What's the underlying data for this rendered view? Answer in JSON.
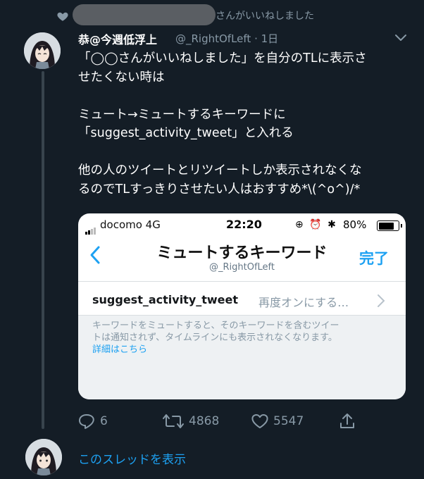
{
  "social_context": {
    "text": "さんがいいねしました"
  },
  "tweet": {
    "author_name": "恭@今週低浮上",
    "handle_time": "@_RightOfLeft · 1日",
    "lines": [
      "「◯◯さんがいいねしました」を自分のTLに表示さ",
      "せたくない時は",
      "",
      "ミュート→ミュートするキーワードに",
      "「suggest_activity_tweet」と入れる",
      "",
      "他の人のツイートとリツイートしか表示されなくな",
      "るのでTLすっきりさせたい人はおすすめ*\\(^o^)/*"
    ]
  },
  "embedded_screenshot": {
    "carrier": "docomo  4G",
    "time": "22:20",
    "battery": "80%",
    "battery_level": 0.8,
    "nav_title": "ミュートするキーワード",
    "nav_subtitle": "@_RightOfLeft",
    "done_label": "完了",
    "keyword": "suggest_activity_tweet",
    "keyword_expiry": "再度オンにする…",
    "help_line1": "キーワードをミュートすると、そのキーワードを含むツイー",
    "help_line2": "トは通知されず、タイムラインにも表示されなくなります。",
    "help_link": "詳細はこちら"
  },
  "actions": {
    "reply_count": "6",
    "retweet_count": "4868",
    "like_count": "5547"
  },
  "show_thread_label": "このスレッドを表示",
  "colors": {
    "background": "#141d26",
    "accent": "#1da1f2",
    "muted": "#8899a6"
  }
}
